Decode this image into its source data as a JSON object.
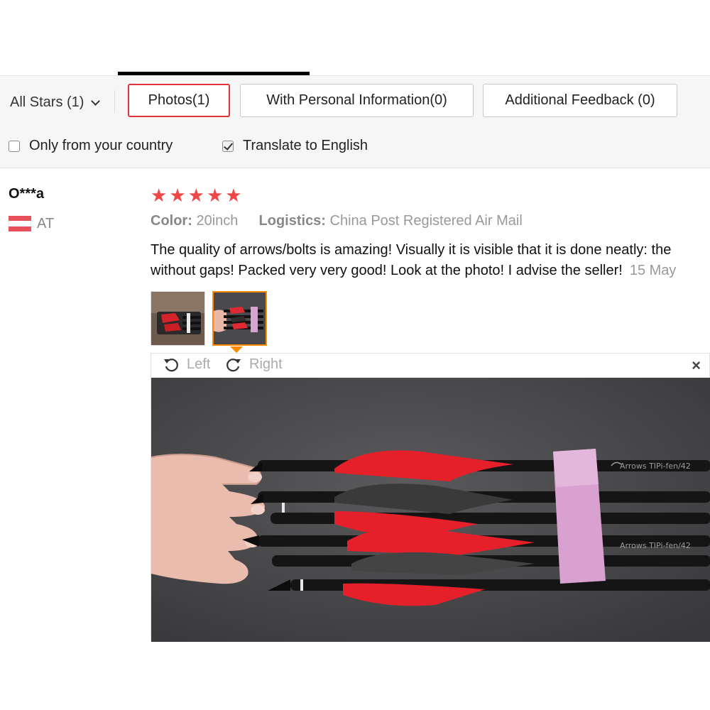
{
  "filter_bar": {
    "stars_select": "All Stars (1)",
    "buttons": {
      "photos": "Photos(1)",
      "personal": "With Personal Information(0)",
      "additional": "Additional Feedback (0)"
    },
    "checkboxes": {
      "only_country": {
        "label": "Only from your country",
        "checked": false
      },
      "translate": {
        "label": "Translate to English",
        "checked": true
      }
    }
  },
  "review": {
    "user_name": "O***a",
    "country_code": "AT",
    "rating": 5,
    "color_label": "Color:",
    "color_value": "20inch",
    "logistics_label": "Logistics:",
    "logistics_value": "China Post Registered Air Mail",
    "text_line1": "The quality of arrows/bolts is amazing! Visually it is visible that it is done neatly: the",
    "text_line2": "without gaps! Packed very very good! Look at the photo! I advise the seller!",
    "date": "15 May"
  },
  "viewer": {
    "rotate_left": "Left",
    "rotate_right": "Right",
    "close": "×"
  },
  "colors": {
    "accent_red": "#e2333a",
    "star_red": "#f04646",
    "selected_orange": "#ff8a00",
    "flag_red": "#e8505b"
  }
}
